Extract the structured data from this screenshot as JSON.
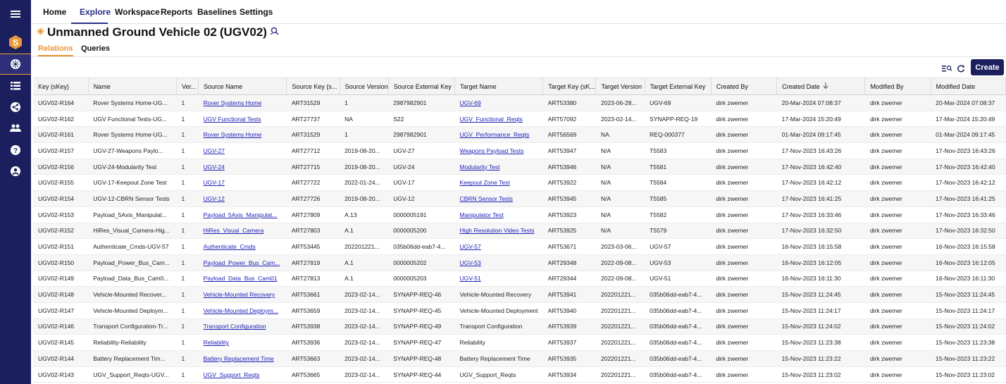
{
  "nav": {
    "items": [
      "Home",
      "Explore",
      "Workspace",
      "Reports",
      "Baselines",
      "Settings"
    ]
  },
  "page": {
    "title_main": "Unmanned Ground Vehicle 02",
    "title_key": "(UGV02)"
  },
  "tabs": [
    "Relations",
    "Queries"
  ],
  "toolbar": {
    "create_label": "Create"
  },
  "table": {
    "columns": [
      "Key (sKey)",
      "Name",
      "Ver...",
      "Source Name",
      "Source Key (s...",
      "Source Version",
      "Source External Key",
      "Target Name",
      "Target Key (sK...",
      "Target Version",
      "Target External Key",
      "Created By",
      "Created Date",
      "Modified By",
      "Modified Date"
    ],
    "sorted_column": "Created Date",
    "sort_direction": "descending",
    "rows": [
      [
        "UGV02-R164",
        "Rover Systems Home-UG...",
        "1",
        "Rover Systems Home",
        "ART31529",
        "1",
        "2987982901",
        "UGV-69",
        "ART53380",
        "2023-06-28...",
        "UGV-69",
        "dirk zwemer",
        "20-Mar-2024 07:08:37",
        "dirk zwemer",
        "20-Mar-2024 07:08:37"
      ],
      [
        "UGV02-R162",
        "UGV Functional Tests-UG...",
        "1",
        "UGV Functional Tests",
        "ART27737",
        "NA",
        "S22",
        "UGV_Functional_Reqts",
        "ART57092",
        "2023-02-14...",
        "SYNAPP-REQ-19",
        "dirk zwemer",
        "17-Mar-2024 15:20:49",
        "dirk zwemer",
        "17-Mar-2024 15:20:49"
      ],
      [
        "UGV02-R161",
        "Rover Systems Home-UG...",
        "1",
        "Rover Systems Home",
        "ART31529",
        "1",
        "2987982901",
        "UGV_Performance_Reqts",
        "ART56569",
        "NA",
        "REQ-000377",
        "dirk zwemer",
        "01-Mar-2024 09:17:45",
        "dirk zwemer",
        "01-Mar-2024 09:17:45"
      ],
      [
        "UGV02-R157",
        "UGV-27-Weapons Paylo...",
        "1",
        "UGV-27",
        "ART27712",
        "2019-08-20...",
        "UGV-27",
        "Weapons Payload Tests",
        "ART53947",
        "N/A",
        "T5583",
        "dirk zwemer",
        "17-Nov-2023 16:43:26",
        "dirk zwemer",
        "17-Nov-2023 16:43:26"
      ],
      [
        "UGV02-R156",
        "UGV-24-Modularity Test",
        "1",
        "UGV-24",
        "ART27715",
        "2019-08-20...",
        "UGV-24",
        "Modularity Test",
        "ART53946",
        "N/A",
        "T5581",
        "dirk zwemer",
        "17-Nov-2023 16:42:40",
        "dirk zwemer",
        "17-Nov-2023 16:42:40"
      ],
      [
        "UGV02-R155",
        "UGV-17-Keepout Zone Test",
        "1",
        "UGV-17",
        "ART27722",
        "2022-01-24...",
        "UGV-17",
        "Keepout Zone Test",
        "ART53922",
        "N/A",
        "T5584",
        "dirk zwemer",
        "17-Nov-2023 16:42:12",
        "dirk zwemer",
        "17-Nov-2023 16:42:12"
      ],
      [
        "UGV02-R154",
        "UGV-12-CBRN Sensor Tests",
        "1",
        "UGV-12",
        "ART27726",
        "2019-08-20...",
        "UGV-12",
        "CBRN Sensor Tests",
        "ART53945",
        "N/A",
        "T5585",
        "dirk zwemer",
        "17-Nov-2023 16:41:25",
        "dirk zwemer",
        "17-Nov-2023 16:41:25"
      ],
      [
        "UGV02-R153",
        "Payload_5Axis_Manipulat...",
        "1",
        "Payload_5Axis_Manipulat...",
        "ART27809",
        "A.13",
        "0000005191",
        "Manipulator Test",
        "ART53923",
        "N/A",
        "T5582",
        "dirk zwemer",
        "17-Nov-2023 16:33:46",
        "dirk zwemer",
        "17-Nov-2023 16:33:46"
      ],
      [
        "UGV02-R152",
        "HiRes_Visual_Camera-Hig...",
        "1",
        "HiRes_Visual_Camera",
        "ART27803",
        "A.1",
        "0000005200",
        "High Resolution Video Tests",
        "ART53925",
        "N/A",
        "T5579",
        "dirk zwemer",
        "17-Nov-2023 16:32:50",
        "dirk zwemer",
        "17-Nov-2023 16:32:50"
      ],
      [
        "UGV02-R151",
        "Authenticate_Cmds-UGV-57",
        "1",
        "Authenticate_Cmds",
        "ART53445",
        "202201221...",
        "035b06dd-eab7-4...",
        "UGV-57",
        "ART53671",
        "2023-03-06...",
        "UGV-57",
        "dirk zwemer",
        "16-Nov-2023 16:15:58",
        "dirk zwemer",
        "16-Nov-2023 16:15:58"
      ],
      [
        "UGV02-R150",
        "Payload_Power_Bus_Cam...",
        "1",
        "Payload_Power_Bus_Cam...",
        "ART27819",
        "A.1",
        "0000005202",
        "UGV-53",
        "ART29348",
        "2022-09-08...",
        "UGV-53",
        "dirk zwemer",
        "16-Nov-2023 16:12:05",
        "dirk zwemer",
        "16-Nov-2023 16:12:05"
      ],
      [
        "UGV02-R149",
        "Payload_Data_Bus_Cam0...",
        "1",
        "Payload_Data_Bus_Cam01",
        "ART27813",
        "A.1",
        "0000005203",
        "UGV-51",
        "ART29344",
        "2022-09-08...",
        "UGV-51",
        "dirk zwemer",
        "16-Nov-2023 16:11:30",
        "dirk zwemer",
        "16-Nov-2023 16:11:30"
      ],
      [
        "UGV02-R148",
        "Vehicle-Mounted Recover...",
        "1",
        "Vehicle-Mounted Recovery",
        "ART53661",
        "2023-02-14...",
        "SYNAPP-REQ-46",
        "Vehicle-Mounted Recovery",
        "ART53941",
        "202201221...",
        "035b06dd-eab7-4...",
        "dirk zwemer",
        "15-Nov-2023 11:24:45",
        "dirk zwemer",
        "15-Nov-2023 11:24:45"
      ],
      [
        "UGV02-R147",
        "Vehicle-Mounted Deploym...",
        "1",
        "Vehicle-Mounted Deploym...",
        "ART53659",
        "2023-02-14...",
        "SYNAPP-REQ-45",
        "Vehicle-Mounted Deployment",
        "ART53940",
        "202201221...",
        "035b06dd-eab7-4...",
        "dirk zwemer",
        "15-Nov-2023 11:24:17",
        "dirk zwemer",
        "15-Nov-2023 11:24:17"
      ],
      [
        "UGV02-R146",
        "Transport Configuration-Tr...",
        "1",
        "Transport Configuration",
        "ART53938",
        "2023-02-14...",
        "SYNAPP-REQ-49",
        "Transport Configuration",
        "ART53939",
        "202201221...",
        "035b06dd-eab7-4...",
        "dirk zwemer",
        "15-Nov-2023 11:24:02",
        "dirk zwemer",
        "15-Nov-2023 11:24:02"
      ],
      [
        "UGV02-R145",
        "Reliability-Reliability",
        "1",
        "Reliability",
        "ART53936",
        "2023-02-14...",
        "SYNAPP-REQ-47",
        "Reliability",
        "ART53937",
        "202201221...",
        "035b06dd-eab7-4...",
        "dirk zwemer",
        "15-Nov-2023 11:23:38",
        "dirk zwemer",
        "15-Nov-2023 11:23:38"
      ],
      [
        "UGV02-R144",
        "Battery Replacement Tim...",
        "1",
        "Battery Replacement Time",
        "ART53663",
        "2023-02-14...",
        "SYNAPP-REQ-48",
        "Battery Replacement Time",
        "ART53935",
        "202201221...",
        "035b06dd-eab7-4...",
        "dirk zwemer",
        "15-Nov-2023 11:23:22",
        "dirk zwemer",
        "15-Nov-2023 11:23:22"
      ],
      [
        "UGV02-R143",
        "UGV_Support_Reqts-UGV...",
        "1",
        "UGV_Support_Reqts",
        "ART53665",
        "2023-02-14...",
        "SYNAPP-REQ-44",
        "UGV_Support_Reqts",
        "ART53934",
        "202201221...",
        "035b06dd-eab7-4...",
        "dirk zwemer",
        "15-Nov-2023 11:23:02",
        "dirk zwemer",
        "15-Nov-2023 11:23:02"
      ]
    ],
    "link_columns": [
      3
    ],
    "target_link_rows": [
      0,
      1,
      2,
      3,
      4,
      5,
      6,
      7,
      8,
      9,
      10,
      11
    ]
  },
  "colors": {
    "sidebar": "#1c1f5e",
    "accent_orange": "#e8973a",
    "nav_active": "#2a2f86",
    "link": "#1a1fb3"
  },
  "icons": [
    "menu-icon",
    "logo-s-icon",
    "explore-icon",
    "list-icon",
    "share-icon",
    "users-icon",
    "help-icon",
    "account-icon",
    "sparkle-icon",
    "search-tree-icon",
    "filter-list-icon",
    "refresh-icon"
  ]
}
